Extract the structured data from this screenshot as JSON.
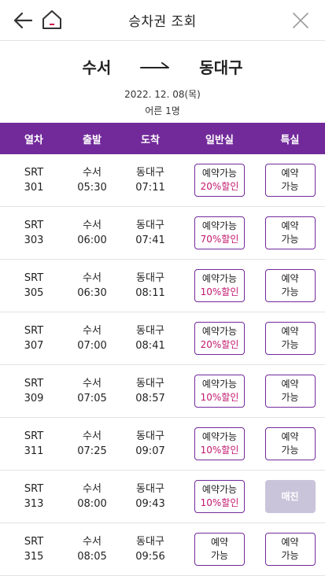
{
  "header": {
    "title": "승차권 조회"
  },
  "route": {
    "from": "수서",
    "to": "동대구",
    "date": "2022. 12. 08(목)",
    "passengers": "어른 1명"
  },
  "table": {
    "headers": [
      "열차",
      "출발",
      "도착",
      "일반실",
      "특실"
    ],
    "rows": [
      {
        "train_type": "SRT",
        "train_no": "301",
        "dep_station": "수서",
        "dep_time": "05:30",
        "arr_station": "동대구",
        "arr_time": "07:11",
        "general": {
          "line1": "예약가능",
          "line2": "20%할인"
        },
        "special": {
          "line1": "예약",
          "line2": "가능"
        }
      },
      {
        "train_type": "SRT",
        "train_no": "303",
        "dep_station": "수서",
        "dep_time": "06:00",
        "arr_station": "동대구",
        "arr_time": "07:41",
        "general": {
          "line1": "예약가능",
          "line2": "70%할인"
        },
        "special": {
          "line1": "예약",
          "line2": "가능"
        }
      },
      {
        "train_type": "SRT",
        "train_no": "305",
        "dep_station": "수서",
        "dep_time": "06:30",
        "arr_station": "동대구",
        "arr_time": "08:11",
        "general": {
          "line1": "예약가능",
          "line2": "10%할인"
        },
        "special": {
          "line1": "예약",
          "line2": "가능"
        }
      },
      {
        "train_type": "SRT",
        "train_no": "307",
        "dep_station": "수서",
        "dep_time": "07:00",
        "arr_station": "동대구",
        "arr_time": "08:41",
        "general": {
          "line1": "예약가능",
          "line2": "20%할인"
        },
        "special": {
          "line1": "예약",
          "line2": "가능"
        }
      },
      {
        "train_type": "SRT",
        "train_no": "309",
        "dep_station": "수서",
        "dep_time": "07:05",
        "arr_station": "동대구",
        "arr_time": "08:57",
        "general": {
          "line1": "예약가능",
          "line2": "10%할인"
        },
        "special": {
          "line1": "예약",
          "line2": "가능"
        }
      },
      {
        "train_type": "SRT",
        "train_no": "311",
        "dep_station": "수서",
        "dep_time": "07:25",
        "arr_station": "동대구",
        "arr_time": "09:07",
        "general": {
          "line1": "예약가능",
          "line2": "10%할인"
        },
        "special": {
          "line1": "예약",
          "line2": "가능"
        }
      },
      {
        "train_type": "SRT",
        "train_no": "313",
        "dep_station": "수서",
        "dep_time": "08:00",
        "arr_station": "동대구",
        "arr_time": "09:43",
        "general": {
          "line1": "예약가능",
          "line2": "10%할인"
        },
        "special": {
          "soldout": "매진"
        }
      },
      {
        "train_type": "SRT",
        "train_no": "315",
        "dep_station": "수서",
        "dep_time": "08:05",
        "arr_station": "동대구",
        "arr_time": "09:56",
        "general": {
          "line1": "예약",
          "line2": "가능"
        },
        "special": {
          "line1": "예약",
          "line2": "가능"
        }
      }
    ]
  },
  "icons": {
    "back": "arrow-left-icon",
    "home": "home-icon",
    "close": "close-icon",
    "route_arrow": "arrow-right-icon"
  },
  "colors": {
    "accent": "#722a9b",
    "discount": "#c2186e",
    "soldout_bg": "#c9c4da"
  }
}
